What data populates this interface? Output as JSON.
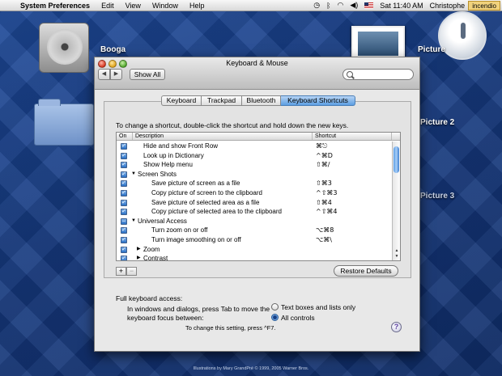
{
  "menubar": {
    "app_name": "System Preferences",
    "items": [
      "Edit",
      "View",
      "Window",
      "Help"
    ],
    "clock": "Sat 11:40 AM",
    "user": "Christophe",
    "badge": "incendio"
  },
  "desktop": {
    "hdd_label": "Booga",
    "picture_labels": [
      "Picture",
      "Picture 2",
      "Picture 3"
    ]
  },
  "window": {
    "title": "Keyboard & Mouse",
    "back_glyph": "◀",
    "forward_glyph": "▶",
    "show_all": "Show All",
    "search_placeholder": "",
    "tabs": [
      "Keyboard",
      "Trackpad",
      "Bluetooth",
      "Keyboard Shortcuts"
    ],
    "active_tab": "Keyboard Shortcuts",
    "instruction": "To change a shortcut, double-click the shortcut and hold down the new keys.",
    "columns": {
      "on": "On",
      "description": "Description",
      "shortcut": "Shortcut"
    },
    "rows": [
      {
        "desc": "Hide and show Front Row",
        "shortcut": "⌘⎋",
        "level": 1,
        "checked": true
      },
      {
        "desc": "Look up in Dictionary",
        "shortcut": "^⌘D",
        "level": 1,
        "checked": true
      },
      {
        "desc": "Show Help menu",
        "shortcut": "⇧⌘/",
        "level": 1,
        "checked": true
      },
      {
        "desc": "Screen Shots",
        "shortcut": "",
        "level": 0,
        "checked": true,
        "expanded": true
      },
      {
        "desc": "Save picture of screen as a file",
        "shortcut": "⇧⌘3",
        "level": 2,
        "checked": true
      },
      {
        "desc": "Copy picture of screen to the clipboard",
        "shortcut": "^⇧⌘3",
        "level": 2,
        "checked": true
      },
      {
        "desc": "Save picture of selected area as a file",
        "shortcut": "⇧⌘4",
        "level": 2,
        "checked": true
      },
      {
        "desc": "Copy picture of selected area to the clipboard",
        "shortcut": "^⇧⌘4",
        "level": 2,
        "checked": true
      },
      {
        "desc": "Universal Access",
        "shortcut": "",
        "level": 0,
        "checked": "mixed",
        "expanded": true
      },
      {
        "desc": "Turn zoom on or off",
        "shortcut": "⌥⌘8",
        "level": 2,
        "checked": true
      },
      {
        "desc": "Turn image smoothing on or off",
        "shortcut": "⌥⌘\\",
        "level": 2,
        "checked": true
      },
      {
        "desc": "Zoom",
        "shortcut": "",
        "level": 1,
        "checked": true,
        "expanded": false
      },
      {
        "desc": "Contrast",
        "shortcut": "",
        "level": 1,
        "checked": true,
        "expanded": false
      }
    ],
    "plus": "+",
    "minus": "−",
    "restore_defaults": "Restore Defaults",
    "full_keyboard_access": "Full keyboard access:",
    "fka_description": "In windows and dialogs, press Tab to move the keyboard focus between:",
    "radio_options": [
      "Text boxes and lists only",
      "All controls"
    ],
    "radio_selected": "All controls",
    "change_note": "To change this setting, press ^F7.",
    "help": "?"
  },
  "footer": {
    "credit": "Illustrations by Mary GrandPré © 1999, 2005 Warner Bros."
  }
}
